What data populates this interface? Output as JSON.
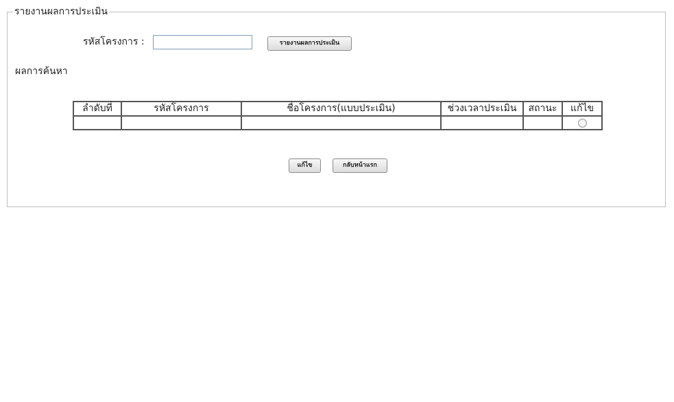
{
  "report": {
    "legend": "รายงานผลการประเมิน",
    "project_code_label": "รหัสโครงการ :",
    "project_code_value": "",
    "report_button_label": "รายงานผลการประเมิน"
  },
  "results": {
    "title": "ผลการค้นหา",
    "columns": [
      "ลำดับที่",
      "รหัสโครงการ",
      "ชื่อโครงการ(แบบประเมิน)",
      "ช่วงเวลาประเมิน",
      "สถานะ",
      "แก้ไข"
    ],
    "rows": [
      {
        "seq": "",
        "code": "",
        "name": "",
        "period": "",
        "status": ""
      }
    ]
  },
  "actions": {
    "edit_label": "แก้ไข",
    "back_label": "กลับหน้าแรก"
  }
}
